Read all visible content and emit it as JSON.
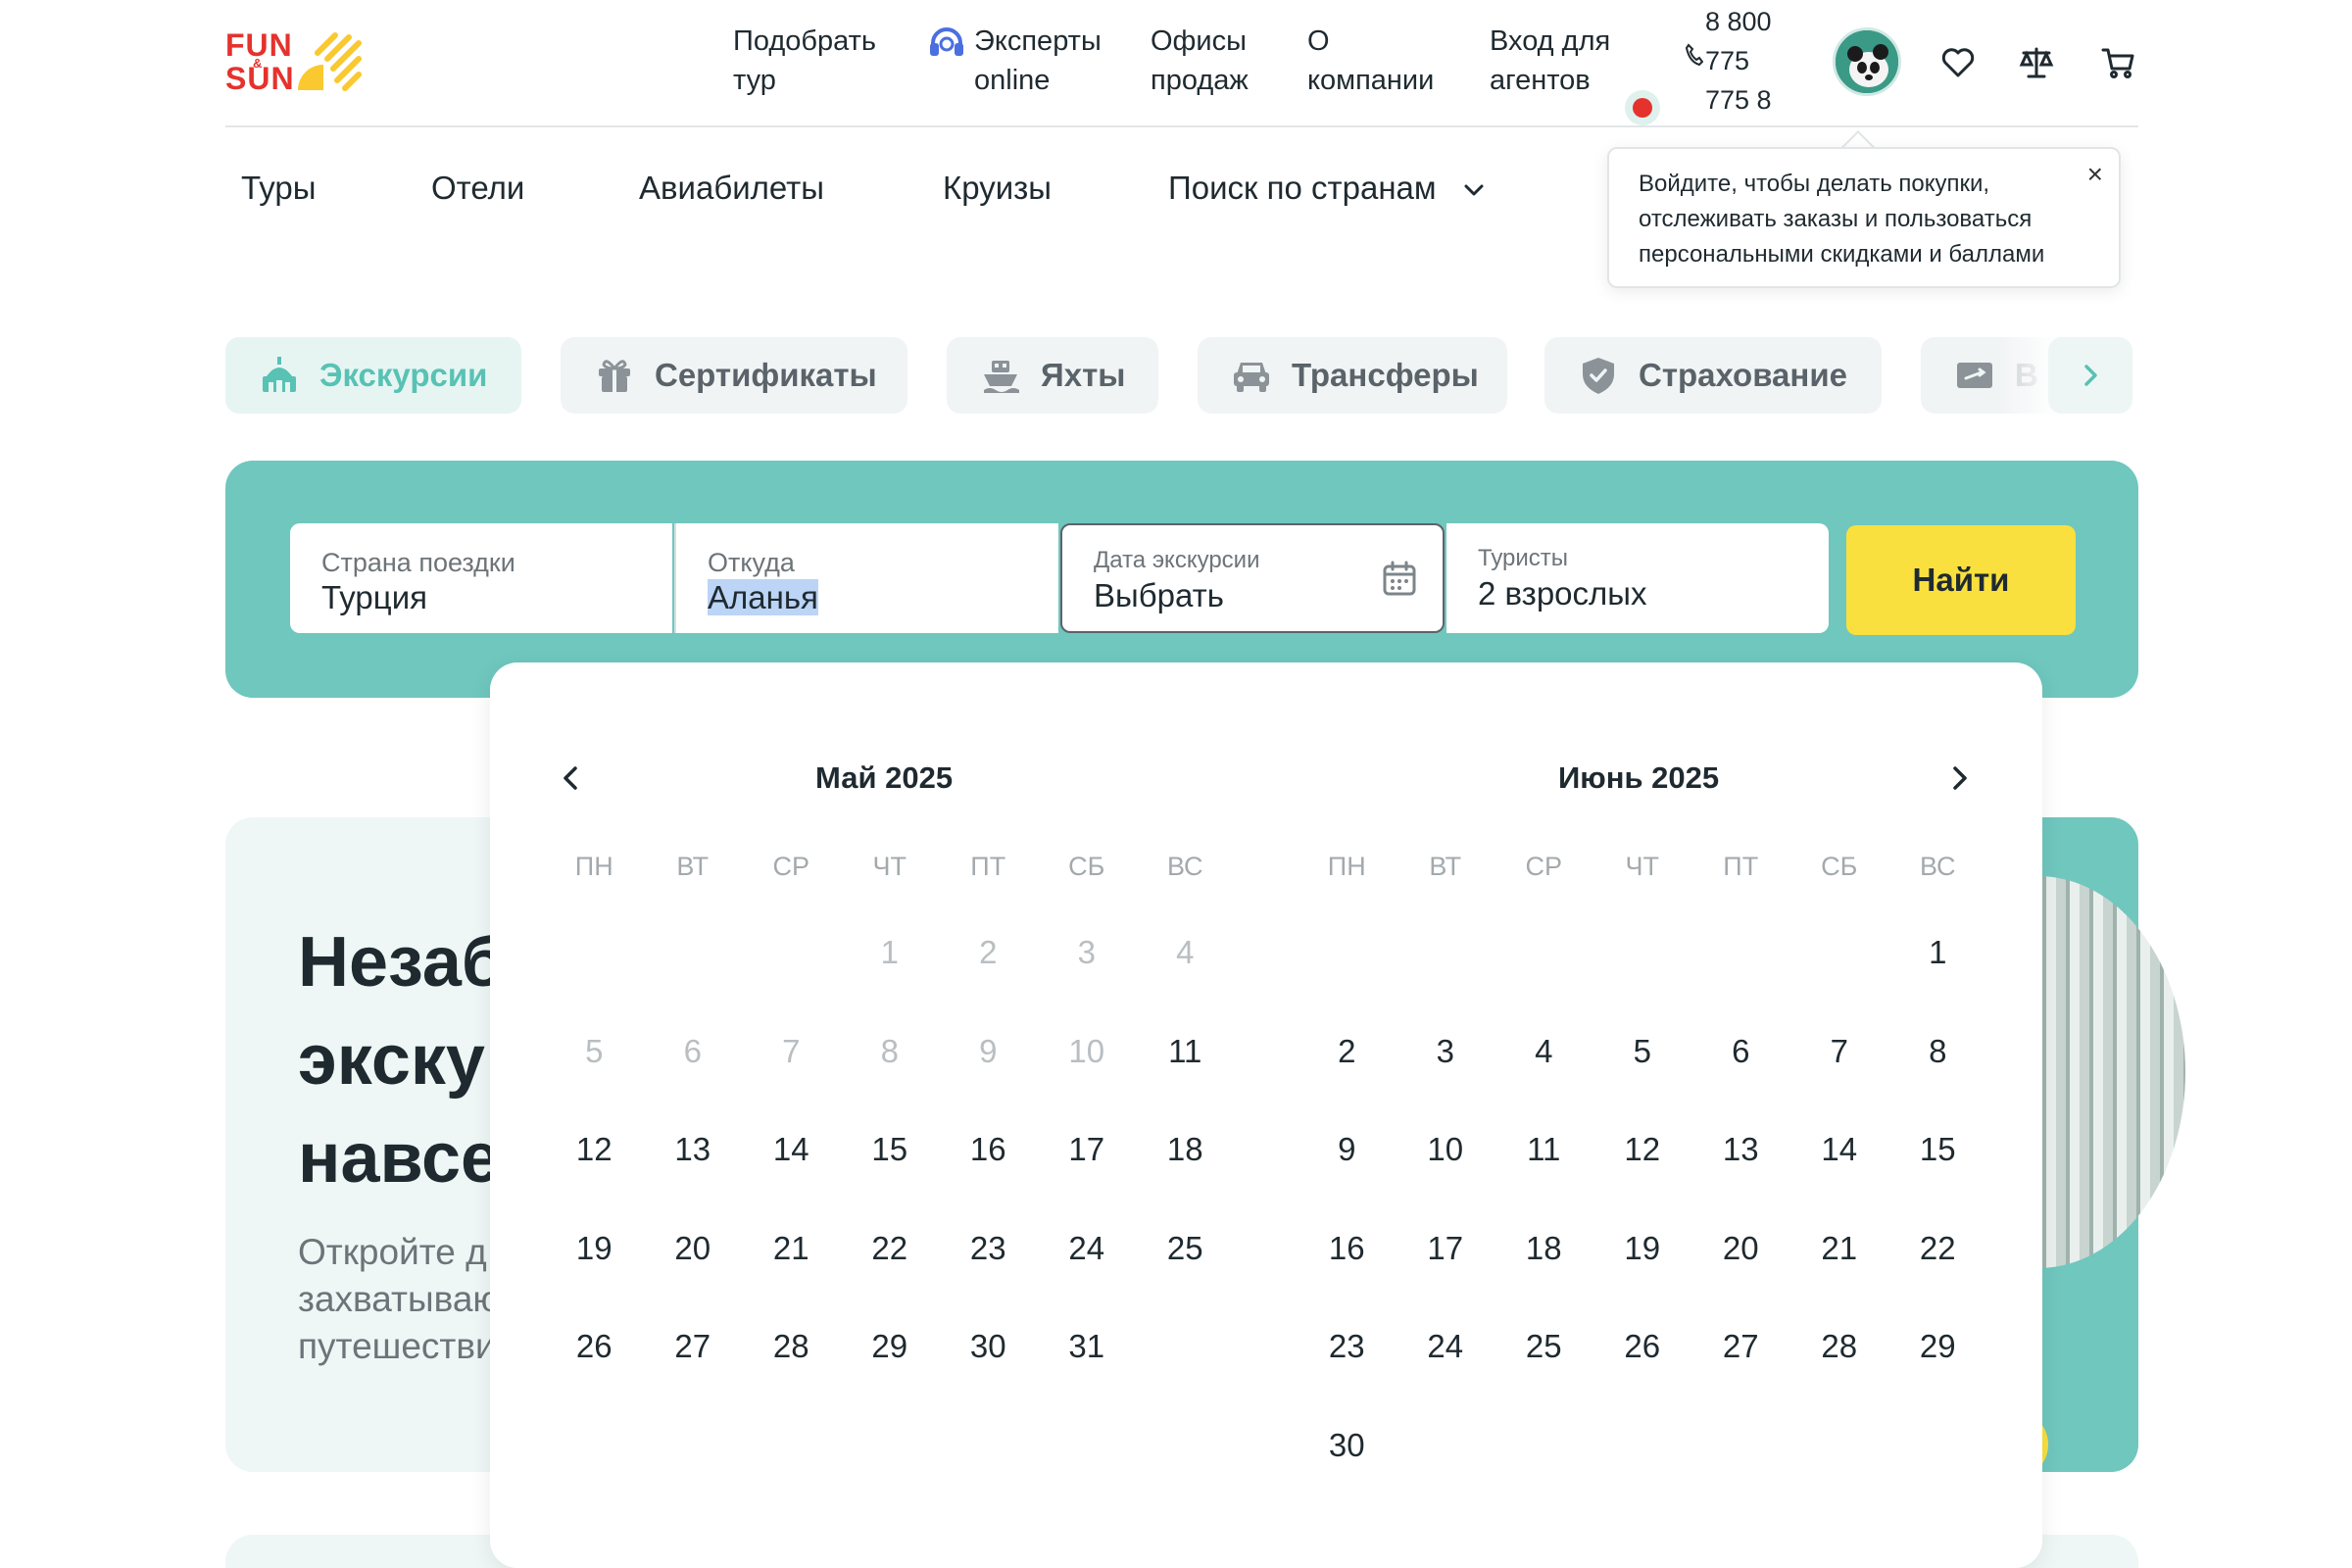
{
  "header": {
    "logo": {
      "line1": "FUN",
      "amp": "&",
      "line2": "SUN"
    },
    "nav": [
      {
        "line1": "Подобрать",
        "line2": "тур"
      },
      {
        "line1": "Эксперты",
        "line2": "online"
      },
      {
        "line1": "Офисы",
        "line2": "продаж"
      },
      {
        "line1": "О",
        "line2": "компании"
      },
      {
        "line1": "Вход для",
        "line2": "агентов"
      }
    ],
    "phone": {
      "line1": "8 800",
      "line2": "775",
      "line3": "775 8"
    },
    "icons": [
      "phone-icon",
      "avatar",
      "heart-icon",
      "scales-icon",
      "cart-icon"
    ]
  },
  "secondary_nav": {
    "items": [
      "Туры",
      "Отели",
      "Авиабилеты",
      "Круизы",
      "Поиск по странам"
    ]
  },
  "tooltip": {
    "line1": "Войдите, чтобы делать покупки,",
    "line2": "отслеживать заказы и пользоваться",
    "line3": "персональными скидками и баллами",
    "close": "×"
  },
  "categories": [
    {
      "label": "Экскурсии",
      "icon": "excursion-icon",
      "active": true
    },
    {
      "label": "Сертификаты",
      "icon": "gift-icon",
      "active": false
    },
    {
      "label": "Яхты",
      "icon": "yacht-icon",
      "active": false
    },
    {
      "label": "Трансферы",
      "icon": "car-icon",
      "active": false
    },
    {
      "label": "Страхование",
      "icon": "shield-icon",
      "active": false
    },
    {
      "label": "В",
      "icon": "ticket-icon",
      "active": false
    }
  ],
  "search": {
    "country": {
      "label": "Страна поездки",
      "value": "Турция"
    },
    "from": {
      "label": "Откуда",
      "value": "Аланья"
    },
    "date": {
      "label": "Дата экскурсии",
      "value": "Выбрать"
    },
    "tourists": {
      "label": "Туристы",
      "value": "2 взрослых"
    },
    "button": "Найти"
  },
  "hero": {
    "title_line1": "Незаб",
    "title_line2": "экску",
    "title_line3": "навсе",
    "sub_line1": "Откройте д",
    "sub_line2": "захватываю",
    "sub_line3": "путешестви"
  },
  "calendar": {
    "weekdays": [
      "ПН",
      "ВТ",
      "СР",
      "ЧТ",
      "ПТ",
      "СБ",
      "ВС"
    ],
    "months": [
      {
        "title": "Май 2025",
        "leading_blanks": 3,
        "days": [
          {
            "d": "1",
            "off": true
          },
          {
            "d": "2",
            "off": true
          },
          {
            "d": "3",
            "off": true
          },
          {
            "d": "4",
            "off": true
          },
          {
            "d": "5",
            "off": true
          },
          {
            "d": "6",
            "off": true
          },
          {
            "d": "7",
            "off": true
          },
          {
            "d": "8",
            "off": true
          },
          {
            "d": "9",
            "off": true
          },
          {
            "d": "10",
            "off": true
          },
          {
            "d": "11",
            "off": false
          },
          {
            "d": "12",
            "off": false
          },
          {
            "d": "13",
            "off": false
          },
          {
            "d": "14",
            "off": false
          },
          {
            "d": "15",
            "off": false
          },
          {
            "d": "16",
            "off": false
          },
          {
            "d": "17",
            "off": false
          },
          {
            "d": "18",
            "off": false
          },
          {
            "d": "19",
            "off": false
          },
          {
            "d": "20",
            "off": false
          },
          {
            "d": "21",
            "off": false
          },
          {
            "d": "22",
            "off": false
          },
          {
            "d": "23",
            "off": false
          },
          {
            "d": "24",
            "off": false
          },
          {
            "d": "25",
            "off": false
          },
          {
            "d": "26",
            "off": false
          },
          {
            "d": "27",
            "off": false
          },
          {
            "d": "28",
            "off": false
          },
          {
            "d": "29",
            "off": false
          },
          {
            "d": "30",
            "off": false
          },
          {
            "d": "31",
            "off": false
          }
        ]
      },
      {
        "title": "Июнь 2025",
        "leading_blanks": 6,
        "days": [
          {
            "d": "1",
            "off": false
          },
          {
            "d": "2",
            "off": false
          },
          {
            "d": "3",
            "off": false
          },
          {
            "d": "4",
            "off": false
          },
          {
            "d": "5",
            "off": false
          },
          {
            "d": "6",
            "off": false
          },
          {
            "d": "7",
            "off": false
          },
          {
            "d": "8",
            "off": false
          },
          {
            "d": "9",
            "off": false
          },
          {
            "d": "10",
            "off": false
          },
          {
            "d": "11",
            "off": false
          },
          {
            "d": "12",
            "off": false
          },
          {
            "d": "13",
            "off": false
          },
          {
            "d": "14",
            "off": false
          },
          {
            "d": "15",
            "off": false
          },
          {
            "d": "16",
            "off": false
          },
          {
            "d": "17",
            "off": false
          },
          {
            "d": "18",
            "off": false
          },
          {
            "d": "19",
            "off": false
          },
          {
            "d": "20",
            "off": false
          },
          {
            "d": "21",
            "off": false
          },
          {
            "d": "22",
            "off": false
          },
          {
            "d": "23",
            "off": false
          },
          {
            "d": "24",
            "off": false
          },
          {
            "d": "25",
            "off": false
          },
          {
            "d": "26",
            "off": false
          },
          {
            "d": "27",
            "off": false
          },
          {
            "d": "28",
            "off": false
          },
          {
            "d": "29",
            "off": false
          },
          {
            "d": "30",
            "off": false
          }
        ]
      }
    ]
  },
  "colors": {
    "brand_red": "#e5322d",
    "brand_yellow": "#f9e03f",
    "teal": "#6fc7be",
    "teal_text": "#58c2b4",
    "text": "#1f2a30"
  }
}
